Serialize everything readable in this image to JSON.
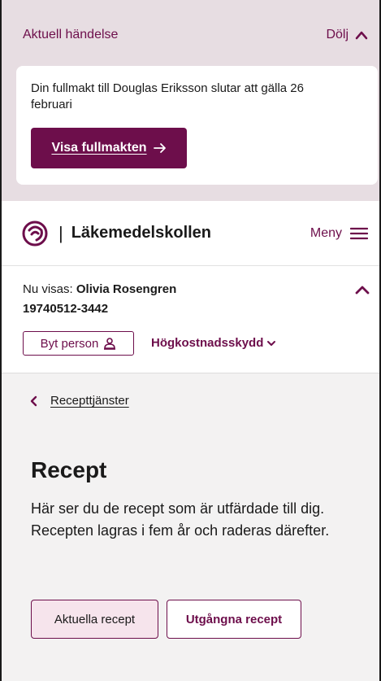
{
  "notice": {
    "title": "Aktuell händelse",
    "hide_label": "Dölj",
    "message": "Din fullmakt till Douglas Eriksson slutar att gälla 26 februari",
    "button_label": "Visa fullmakten"
  },
  "header": {
    "brand": "Läkemedelskollen",
    "separator": "|",
    "menu_label": "Meny"
  },
  "person": {
    "viewing_prefix": "Nu visas: ",
    "name": "Olivia Rosengren",
    "personal_number": "19740512-3442",
    "switch_label": "Byt person",
    "high_cost_label": "Högkostnadsskydd"
  },
  "main": {
    "breadcrumb": "Recepttjänster",
    "title": "Recept",
    "description": "Här ser du de recept som är utfärdade till dig. Recepten lagras i fem år och raderas därefter.",
    "tabs": [
      {
        "label": "Aktuella recept",
        "active": true
      },
      {
        "label": "Utgångna recept",
        "active": false
      }
    ]
  },
  "colors": {
    "accent": "#6d0e4b",
    "notice_bg": "#e7dde2",
    "page_bg": "#f3f2f2",
    "active_tab_bg": "#f6e4ec"
  },
  "icons": [
    "chevron-up-icon",
    "arrow-right-icon",
    "logo-icon",
    "hamburger-icon",
    "person-icon",
    "chevron-down-icon",
    "chevron-left-icon"
  ]
}
